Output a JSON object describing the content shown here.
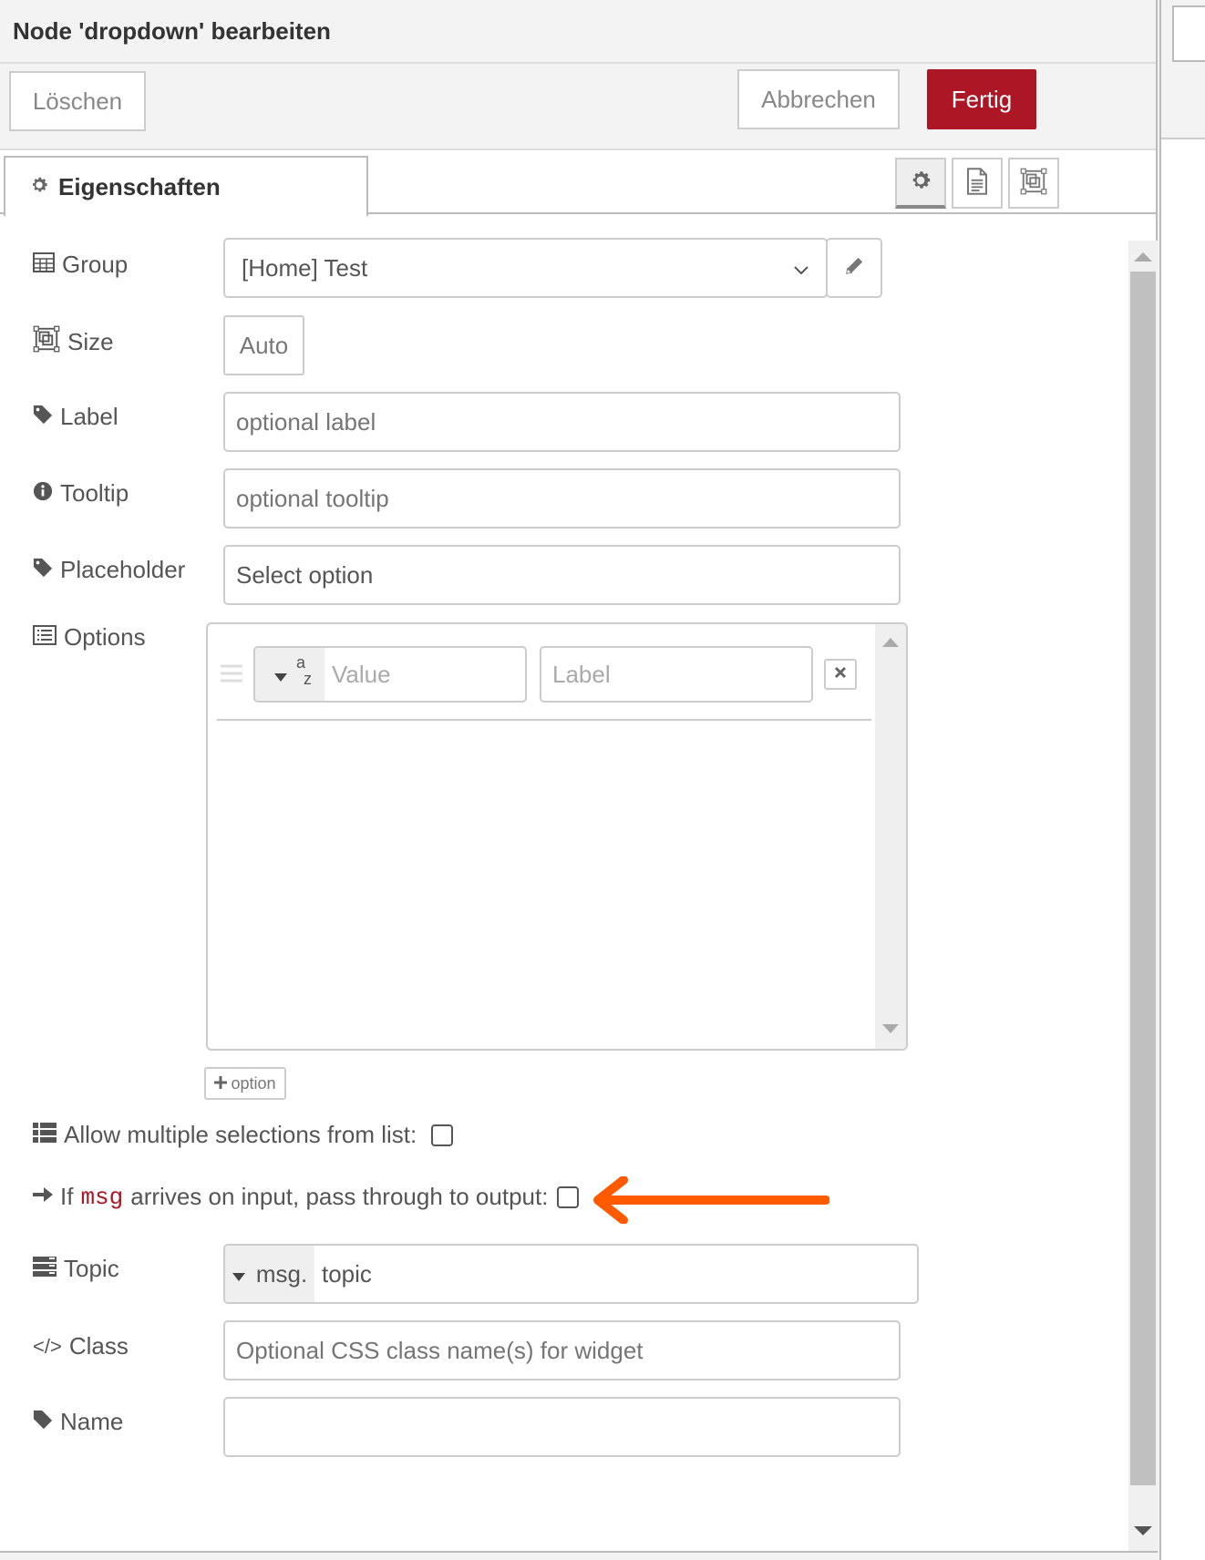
{
  "header": {
    "title": "Node 'dropdown' bearbeiten"
  },
  "toolbar": {
    "delete_label": "Löschen",
    "cancel_label": "Abbrechen",
    "done_label": "Fertig",
    "done_color": "#ad1625"
  },
  "tabs": {
    "properties_label": "Eigenschaften",
    "icons": [
      "gear-icon",
      "description-icon",
      "appearance-icon"
    ]
  },
  "form": {
    "group": {
      "label": "Group",
      "value": "[Home] Test",
      "icon": "table-icon"
    },
    "size": {
      "label": "Size",
      "value": "Auto",
      "icon": "size-icon"
    },
    "label": {
      "label": "Label",
      "placeholder": "optional label",
      "value": "",
      "icon": "tag-icon"
    },
    "tooltip": {
      "label": "Tooltip",
      "placeholder": "optional tooltip",
      "value": "",
      "icon": "info-icon"
    },
    "placeholder": {
      "label": "Placeholder",
      "value": "Select option",
      "icon": "tag-icon"
    },
    "options": {
      "label": "Options",
      "icon": "list-icon",
      "rows": [
        {
          "type_indicator": "a z",
          "value_placeholder": "Value",
          "label_placeholder": "Label"
        }
      ],
      "add_label": "option"
    },
    "multiple": {
      "label": "Allow multiple selections from list:",
      "checked": false
    },
    "passthru": {
      "label_pre": "If",
      "label_code": "msg",
      "label_post": "arrives on input, pass through to output:",
      "checked": false
    },
    "topic": {
      "label": "Topic",
      "prefix": "msg.",
      "value": "topic"
    },
    "class": {
      "label": "Class",
      "placeholder": "Optional CSS class name(s) for widget",
      "value": ""
    },
    "name": {
      "label": "Name"
    }
  },
  "annotation": {
    "color": "#ff5a00"
  }
}
